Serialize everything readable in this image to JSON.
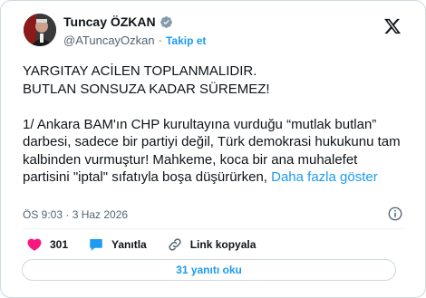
{
  "author": {
    "display_name": "Tuncay ÖZKAN",
    "handle": "@ATuncayOzkan",
    "separator": "·",
    "follow_label": "Takip et",
    "verified": true
  },
  "tweet": {
    "text": "YARGITAY ACİLEN TOPLANMALIDIR.\nBUTLAN SONSUZA KADAR SÜREMEZ!\n\n1/ Ankara BAM'ın CHP kurultayına vurduğu “mutlak butlan” darbesi, sadece bir partiyi değil, Türk demokrasi hukukunu tam kalbinden vurmuştur! Mahkeme, koca bir ana muhalefet partisini \"iptal\" sıfatıyla boşa düşürürken, ",
    "show_more_label": "Daha fazla göster",
    "timestamp": "ÖS 9:03 · 3 Haz 2026"
  },
  "actions": {
    "like_count": "301",
    "reply_label": "Yanıtla",
    "copy_link_label": "Link kopyala"
  },
  "replies_button_label": "31 yanıtı oku",
  "colors": {
    "accent": "#1d9bf0",
    "like": "#f91880",
    "secondary_text": "#536471",
    "border": "#cfd9de"
  }
}
